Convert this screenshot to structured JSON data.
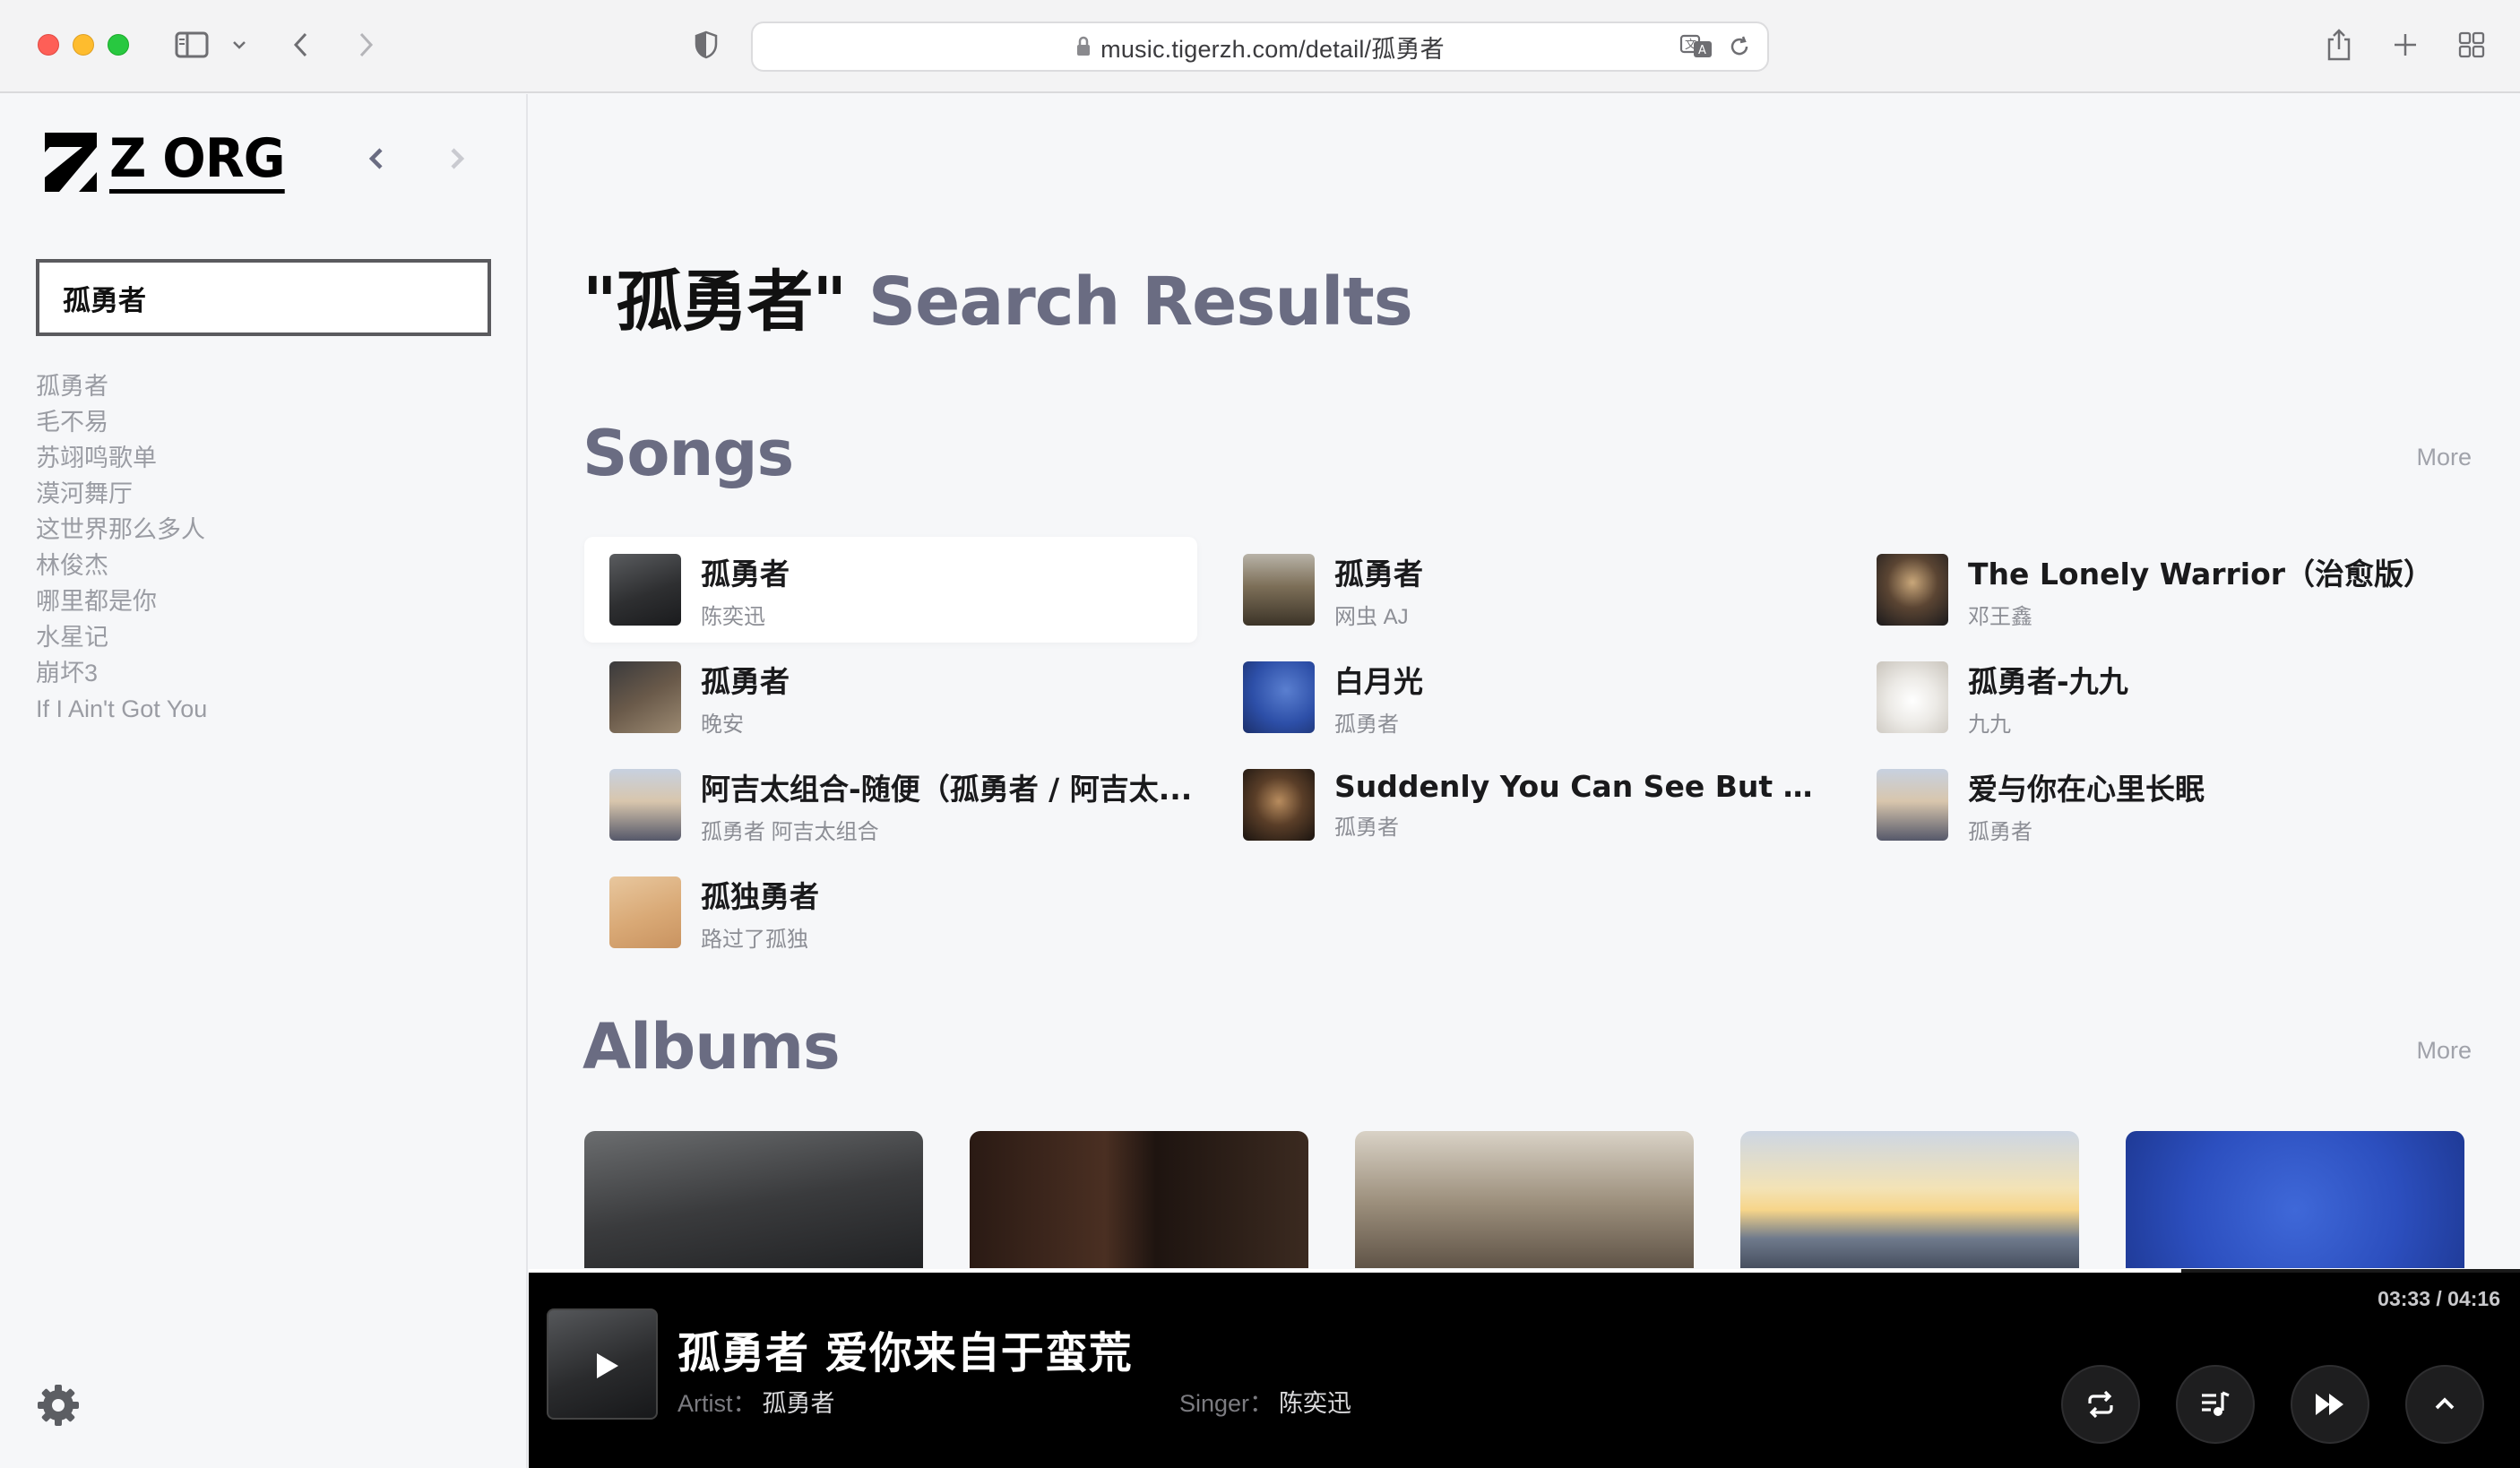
{
  "browser": {
    "url": "music.tigerzh.com/detail/孤勇者"
  },
  "sidebar": {
    "logo_text": "Z ORG",
    "search_value": "孤勇者",
    "history": [
      "孤勇者",
      "毛不易",
      "苏翊鸣歌单",
      "漠河舞厅",
      "这世界那么多人",
      "林俊杰",
      "哪里都是你",
      "水星记",
      "崩坏3",
      "If I Ain't Got You"
    ]
  },
  "main": {
    "heading_query": "\"孤勇者\"",
    "heading_suffix": "Search Results",
    "songs_title": "Songs",
    "albums_title": "Albums",
    "more_label": "More",
    "songs": [
      {
        "title": "孤勇者",
        "artist": "陈奕迅"
      },
      {
        "title": "孤勇者",
        "artist": "网虫 AJ"
      },
      {
        "title": "The Lonely Warrior（治愈版）",
        "artist": "邓王鑫"
      },
      {
        "title": "孤勇者",
        "artist": "晚安"
      },
      {
        "title": "白月光",
        "artist": "孤勇者"
      },
      {
        "title": "孤勇者-九九",
        "artist": "九九"
      },
      {
        "title": "阿吉太组合-随便（孤勇者 / 阿吉太...",
        "artist": "孤勇者 阿吉太组合"
      },
      {
        "title": "Suddenly You Can See But You Can't...",
        "artist": "孤勇者"
      },
      {
        "title": "爱与你在心里长眠",
        "artist": "孤勇者"
      },
      {
        "title": "孤独勇者",
        "artist": "路过了孤独"
      }
    ]
  },
  "player": {
    "title": "孤勇者 爱你来自于蛮荒",
    "artist_label": "Artist：",
    "artist": "孤勇者",
    "singer_label": "Singer：",
    "singer": "陈奕迅",
    "time": "03:33 / 04:16",
    "progress": 0.83
  }
}
